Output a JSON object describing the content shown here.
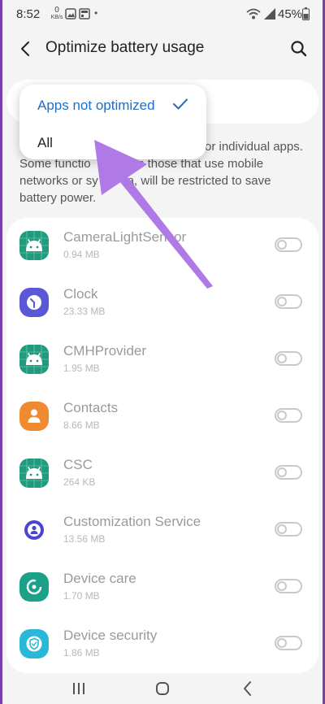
{
  "status_bar": {
    "time": "8:52",
    "net_speed_value": "0",
    "net_speed_unit": "KB/s",
    "battery": "45%"
  },
  "header": {
    "title": "Optimize battery usage"
  },
  "filter_dropdown": {
    "options": [
      {
        "label": "Apps not optimized",
        "selected": true
      },
      {
        "label": "All",
        "selected": false
      }
    ]
  },
  "description": "Turn off optimization for individual apps. Some functions, such as those that use mobile networks or sync data, will be restricted to save battery power.",
  "description_visible": {
    "line1": "or individual apps.",
    "line2a": "Some functio",
    "line2b": "ch as those that use mobile",
    "line3a": "networks or sy",
    "line3b": "a, will be restricted to save",
    "line4": "battery power."
  },
  "apps": [
    {
      "name": "CameraLightSensor",
      "size": "0.94 MB",
      "icon": "android-icon",
      "color": "#1f9c7e",
      "optimized_off": false
    },
    {
      "name": "Clock",
      "size": "23.33 MB",
      "icon": "clock-icon",
      "color": "#5b58d6",
      "optimized_off": false
    },
    {
      "name": "CMHProvider",
      "size": "1.95 MB",
      "icon": "android-icon",
      "color": "#1f9c7e",
      "optimized_off": false
    },
    {
      "name": "Contacts",
      "size": "8.66 MB",
      "icon": "contacts-icon",
      "color": "#f08a30",
      "optimized_off": false
    },
    {
      "name": "CSC",
      "size": "264 KB",
      "icon": "android-icon",
      "color": "#1f9c7e",
      "optimized_off": false
    },
    {
      "name": "Customization Service",
      "size": "13.56 MB",
      "icon": "customization-icon",
      "color": "#4a46d0",
      "optimized_off": false
    },
    {
      "name": "Device care",
      "size": "1.70 MB",
      "icon": "device-care-icon",
      "color": "#1aa188",
      "optimized_off": false
    },
    {
      "name": "Device security",
      "size": "1.86 MB",
      "icon": "device-security-icon",
      "color": "#29b8d8",
      "optimized_off": false
    }
  ],
  "colors": {
    "accent": "#1f6fc5",
    "arrow": "#b07ae6",
    "frame": "#7b3fa8"
  }
}
